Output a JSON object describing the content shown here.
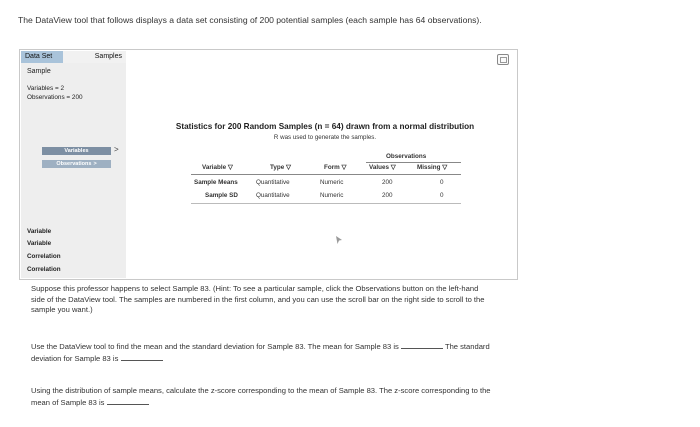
{
  "intro": "The DataView tool that follows displays a data set consisting of 200 potential samples (each sample has 64 observations).",
  "tool": {
    "tabs": {
      "dataset": "Data Set",
      "samples": "Samples"
    },
    "left_panel": {
      "sample_label": "Sample",
      "variables_count": "Variables = 2",
      "observations_count": "Observations = 200",
      "variables_button": "Variables",
      "observations_button": "Observations",
      "arrow": ">",
      "items": [
        "Variable",
        "Variable",
        "Correlation",
        "Correlation"
      ]
    },
    "stats": {
      "title": "Statistics for 200 Random Samples (n = 64) drawn from a normal distribution",
      "subtitle": "R was used to generate the samples.",
      "columns": {
        "variable": "Variable ▽",
        "type": "Type ▽",
        "form": "Form ▽",
        "observations_group": "Observations",
        "values": "Values ▽",
        "missing": "Missing ▽"
      },
      "rows": [
        {
          "variable": "Sample Means",
          "type": "Quantitative",
          "form": "Numeric",
          "values": "200",
          "missing": "0"
        },
        {
          "variable": "Sample SD",
          "type": "Quantitative",
          "form": "Numeric",
          "values": "200",
          "missing": "0"
        }
      ]
    }
  },
  "questions": {
    "q1": "Suppose this professor happens to select Sample 83. (Hint: To see a particular sample, click the Observations button on the left-hand side of the DataView tool. The samples are numbered in the first column, and you can use the scroll bar on the right side to scroll to the sample you want.)",
    "q2_part1": "Use the DataView tool to find the mean and the standard deviation for Sample 83. The mean for Sample 83 is",
    "q2_part2": "The standard deviation for Sample 83 is",
    "q3": "Using the distribution of sample means, calculate the z-score corresponding to the mean of Sample 83. The z-score corresponding to the mean of Sample 83 is"
  }
}
